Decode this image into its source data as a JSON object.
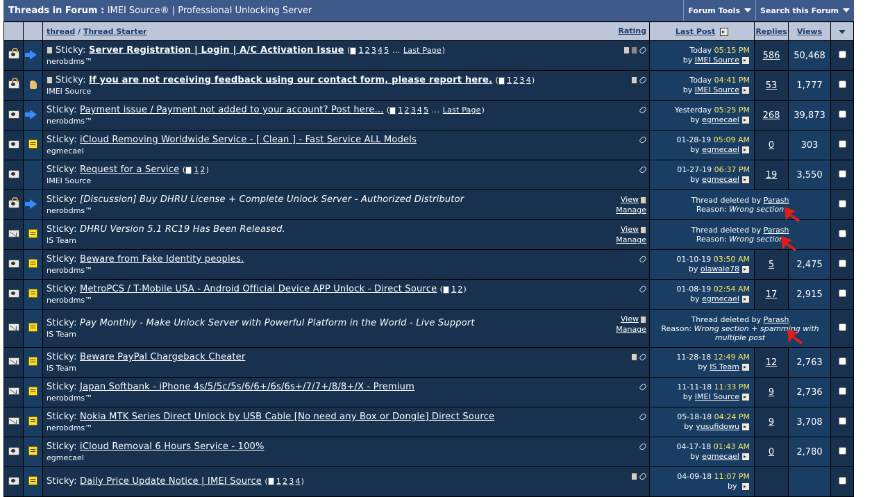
{
  "header": {
    "title": "Threads in Forum",
    "subtitle": "IMEI Source® | Professional Unlocking Server",
    "forum_tools": "Forum Tools",
    "search_forum": "Search this Forum"
  },
  "columns": {
    "thread": "thread",
    "starter": "Thread Starter",
    "rating": "Rating",
    "last_post": "Last Post",
    "replies": "Replies",
    "views": "Views"
  },
  "labels": {
    "by": "by",
    "view": "View",
    "manage": "Manage",
    "deleted_by": "Thread deleted by",
    "reason": "Reason:",
    "last_page": "Last Page",
    "sticky": "Sticky:"
  },
  "threads": [
    {
      "icon1": "folder-lock",
      "icon2": "arrow",
      "title": "Server Registration | Login | A/C Activation Issue",
      "bold": true,
      "pages": [
        "1",
        "2",
        "3",
        "4",
        "5"
      ],
      "more": true,
      "starter": "nerobdms™",
      "date": "Today",
      "time": "05:15 PM",
      "by": "IMEI Source",
      "replies": "586",
      "views": "50,468",
      "flags": "trash-lock-clip"
    },
    {
      "icon1": "folder-lock",
      "icon2": "thumb",
      "title": "If you are not receiving feedback using our contact form, please report here.",
      "bold": true,
      "pages": [
        "1",
        "2",
        "3",
        "4"
      ],
      "more": false,
      "starter": "IMEI Source",
      "date": "Today",
      "time": "04:41 PM",
      "by": "IMEI Source",
      "replies": "53",
      "views": "1,777",
      "flags": "trash-clip"
    },
    {
      "icon1": "folder",
      "icon2": "arrow",
      "title": "Payment issue / Payment not added to your account? Post here...",
      "bold": false,
      "pages": [
        "1",
        "2",
        "3",
        "4",
        "5"
      ],
      "more": true,
      "starter": "nerobdms™",
      "date": "Yesterday",
      "time": "05:25 PM",
      "by": "egmecael",
      "replies": "268",
      "views": "39,873",
      "flags": "clip"
    },
    {
      "icon1": "folder",
      "icon2": "note",
      "title": "iCloud Removing Worldwide Service - [ Clean ] - Fast Service ALL Models",
      "bold": false,
      "pages": [],
      "more": false,
      "starter": "egmecael",
      "date": "01-28-19",
      "time": "05:09 AM",
      "by": "egmecael",
      "replies": "0",
      "views": "303",
      "flags": "clip"
    },
    {
      "icon1": "folder",
      "icon2": "none",
      "title": "Request for a Service",
      "bold": false,
      "pages": [
        "1",
        "2"
      ],
      "more": false,
      "starter": "IMEI Source",
      "date": "01-27-19",
      "time": "06:37 PM",
      "by": "egmecael",
      "replies": "19",
      "views": "3,550",
      "flags": "clip"
    },
    {
      "icon1": "folder-lock",
      "icon2": "arrow",
      "deleted": true,
      "title": "[Discussion] Buy DHRU License + Complete Unlock Server - Authorized Distributor",
      "starter": "nerobdms™",
      "deleter": "Parash",
      "reason": "Wrong section"
    },
    {
      "icon1": "env",
      "icon2": "note",
      "deleted": true,
      "title": "DHRU Version 5.1 RC19 Has Been Released.",
      "starter": "IS Team",
      "deleter": "Parash",
      "reason": "Wrong section"
    },
    {
      "icon1": "folder",
      "icon2": "note",
      "title": "Beware from Fake Identity peoples.",
      "bold": false,
      "pages": [],
      "more": false,
      "starter": "nerobdms™",
      "date": "01-10-19",
      "time": "03:50 AM",
      "by": "olawale78",
      "replies": "5",
      "views": "2,475",
      "flags": "clip"
    },
    {
      "icon1": "folder",
      "icon2": "note",
      "title": "MetroPCS / T-Mobile USA - Android Official Device APP Unlock - Direct Source",
      "bold": false,
      "pages": [
        "1",
        "2"
      ],
      "more": false,
      "starter": "nerobdms™",
      "date": "01-08-19",
      "time": "02:54 AM",
      "by": "egmecael",
      "replies": "17",
      "views": "2,915",
      "flags": "clip"
    },
    {
      "icon1": "env",
      "icon2": "note",
      "deleted": true,
      "tall": true,
      "title": "Pay Monthly - Make Unlock Server with Powerful Platform in the World - Live Support",
      "starter": "IS Team",
      "deleter": "Parash",
      "reason": "Wrong section + spamming with multiple post"
    },
    {
      "icon1": "env",
      "icon2": "note",
      "title": "Beware PayPal Chargeback Cheater",
      "bold": false,
      "pages": [],
      "more": false,
      "starter": "IS Team",
      "date": "11-28-18",
      "time": "12:49 AM",
      "by": "IS Team",
      "replies": "12",
      "views": "2,763",
      "flags": "trash-clip"
    },
    {
      "icon1": "env",
      "icon2": "note",
      "title": "Japan Softbank - iPhone 4s/5/5c/5s/6/6+/6s/6s+/7/7+/8/8+/X - Premium",
      "bold": false,
      "pages": [],
      "more": false,
      "starter": "nerobdms™",
      "date": "11-11-18",
      "time": "11:33 PM",
      "by": "IMEI Source",
      "replies": "9",
      "views": "2,736",
      "flags": "clip"
    },
    {
      "icon1": "env",
      "icon2": "note",
      "title": "Nokia MTK Series Direct Unlock by USB Cable [No need any Box or Dongle] Direct Source",
      "bold": false,
      "pages": [],
      "more": false,
      "starter": "nerobdms™",
      "date": "05-18-18",
      "time": "04:24 PM",
      "by": "yusufidowu",
      "replies": "9",
      "views": "3,708",
      "flags": "clip"
    },
    {
      "icon1": "folder",
      "icon2": "note",
      "title": "iCloud Removal 6 Hours Service - 100%",
      "bold": false,
      "pages": [],
      "more": false,
      "starter": "egmecael",
      "date": "04-17-18",
      "time": "01:43 AM",
      "by": "egmecael",
      "replies": "0",
      "views": "2,780",
      "flags": "clip"
    },
    {
      "icon1": "folder",
      "icon2": "note",
      "title": "Daily Price Update Notice | IMEI Source",
      "bold": false,
      "pages": [
        "1",
        "2",
        "3",
        "4"
      ],
      "more": false,
      "starter": "",
      "date": "04-09-18",
      "time": "11:07 PM",
      "by": "",
      "replies": "",
      "views": "",
      "flags": "trash-clip"
    }
  ],
  "colors": {
    "row": "#17314f",
    "row_alt": "#1a3e63",
    "header": "#3d5a8a",
    "time": "#ffe860",
    "annotation": "#e31b1b"
  }
}
